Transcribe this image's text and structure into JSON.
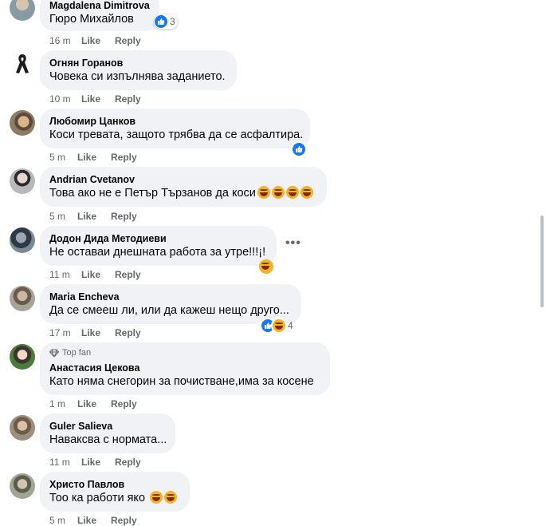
{
  "actions": {
    "like": "Like",
    "reply": "Reply"
  },
  "comments": [
    {
      "author": "Magdalena Dimitrova",
      "text": "Гюро Михайлов",
      "time": "16 m",
      "reaction_count": "3"
    },
    {
      "author": "Огнян Горанов",
      "text": "Човека си изпълнява заданието.",
      "time": "10 m"
    },
    {
      "author": "Любомир Цанков",
      "text": "Коси тревата, защото трябва да се асфалтира.",
      "time": "5 m"
    },
    {
      "author": "Andrian Cvetanov",
      "text": "Това ако не е Петър Тързанов да коси",
      "time": "5 m"
    },
    {
      "author": "Додон Дида Методиеви",
      "text": "Не оставаи днешната работа за утре!!!¡!",
      "time": "11 m"
    },
    {
      "author": "Maria Encheva",
      "text": "Да се смееш ли, или да кажеш нещо друго...",
      "time": "17 m",
      "reaction_count": "4"
    },
    {
      "author": "Анастасия Цекова",
      "badge": "Top fan",
      "text": "Като няма снегорин за почистване,има за косене",
      "time": "1 m"
    },
    {
      "author": "Guler Salieva",
      "text": "Наваксва с нормата...",
      "time": "11 m"
    },
    {
      "author": "Христо Павлов",
      "text": "Тоо ка работи яко",
      "time": "5 m"
    }
  ],
  "colors": {
    "bubble": "#f0f2f5",
    "meta": "#65676b",
    "like": "#1877f2",
    "haha": "#f7b125"
  }
}
